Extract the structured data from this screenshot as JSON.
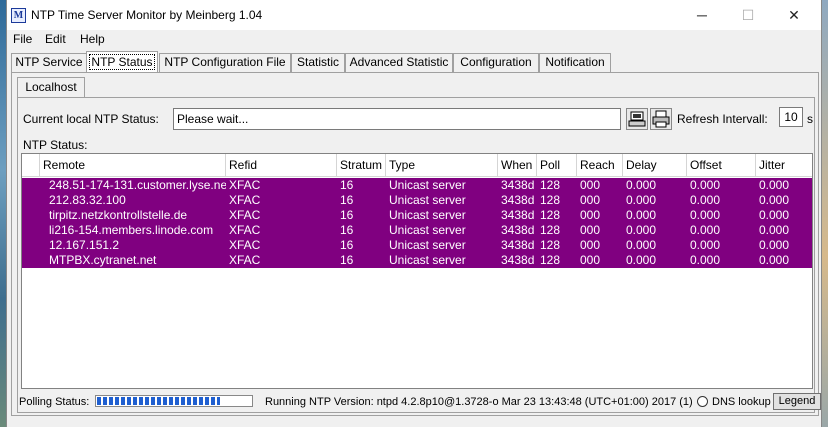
{
  "window": {
    "title": "NTP Time Server Monitor by Meinberg 1.04"
  },
  "titlebar_buttons": [
    "─",
    "☐",
    "✕"
  ],
  "menu": [
    "File",
    "Edit",
    "Help"
  ],
  "tabs": [
    "NTP Service",
    "NTP Status",
    "NTP Configuration File",
    "Statistic",
    "Advanced Statistic",
    "Configuration",
    "Notification"
  ],
  "active_tab": "NTP Status",
  "subtab": "Localhost",
  "status": {
    "label": "Current local NTP Status:",
    "value": "Please wait...",
    "refresh_label": "Refresh Intervall:",
    "refresh_value": "10",
    "refresh_unit": "s"
  },
  "group_label": "NTP Status:",
  "columns": [
    "",
    "Remote",
    "Refid",
    "Stratum",
    "Type",
    "When",
    "Poll",
    "Reach",
    "Delay",
    "Offset",
    "Jitter"
  ],
  "rows": [
    [
      "",
      "248.51-174-131.customer.lyse.net",
      "XFAC",
      "16",
      "Unicast server",
      "3438d",
      "128",
      "000",
      "0.000",
      "0.000",
      "0.000"
    ],
    [
      "",
      "212.83.32.100",
      "XFAC",
      "16",
      "Unicast server",
      "3438d",
      "128",
      "000",
      "0.000",
      "0.000",
      "0.000"
    ],
    [
      "",
      "tirpitz.netzkontrollstelle.de",
      "XFAC",
      "16",
      "Unicast server",
      "3438d",
      "128",
      "000",
      "0.000",
      "0.000",
      "0.000"
    ],
    [
      "",
      "li216-154.members.linode.com",
      "XFAC",
      "16",
      "Unicast server",
      "3438d",
      "128",
      "000",
      "0.000",
      "0.000",
      "0.000"
    ],
    [
      "",
      "12.167.151.2",
      "XFAC",
      "16",
      "Unicast server",
      "3438d",
      "128",
      "000",
      "0.000",
      "0.000",
      "0.000"
    ],
    [
      "",
      "MTPBX.cytranet.net",
      "XFAC",
      "16",
      "Unicast server",
      "3438d",
      "128",
      "000",
      "0.000",
      "0.000",
      "0.000"
    ]
  ],
  "row_color": "#800080",
  "statusbar": {
    "polling_label": "Polling Status:",
    "polling_progress": 0.8,
    "version": "Running NTP Version:  ntpd 4.2.8p10@1.3728-o Mar 23 13:43:48 (UTC+01:00) 2017  (1)",
    "dns_label": "DNS lookup",
    "legend_button": "Legend"
  }
}
